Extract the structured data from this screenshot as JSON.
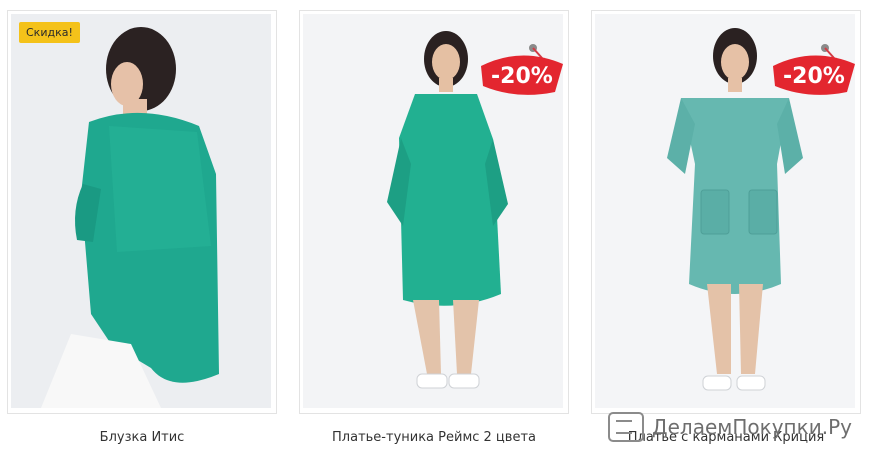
{
  "products": [
    {
      "title": "Блузка Итис",
      "badge": "Скидка!",
      "discount": null
    },
    {
      "title": "Платье-туника Реймс 2 цвета",
      "badge": null,
      "discount": "-20%"
    },
    {
      "title": "Платье с карманами Криция",
      "badge": null,
      "discount": "-20%"
    }
  ],
  "watermark": "ДелаемПокупки.Ру",
  "colors": {
    "garment": "#1fa88f",
    "garment_light": "#66b8b0",
    "sale_tag": "#e3262f",
    "badge": "#f4c21a"
  }
}
